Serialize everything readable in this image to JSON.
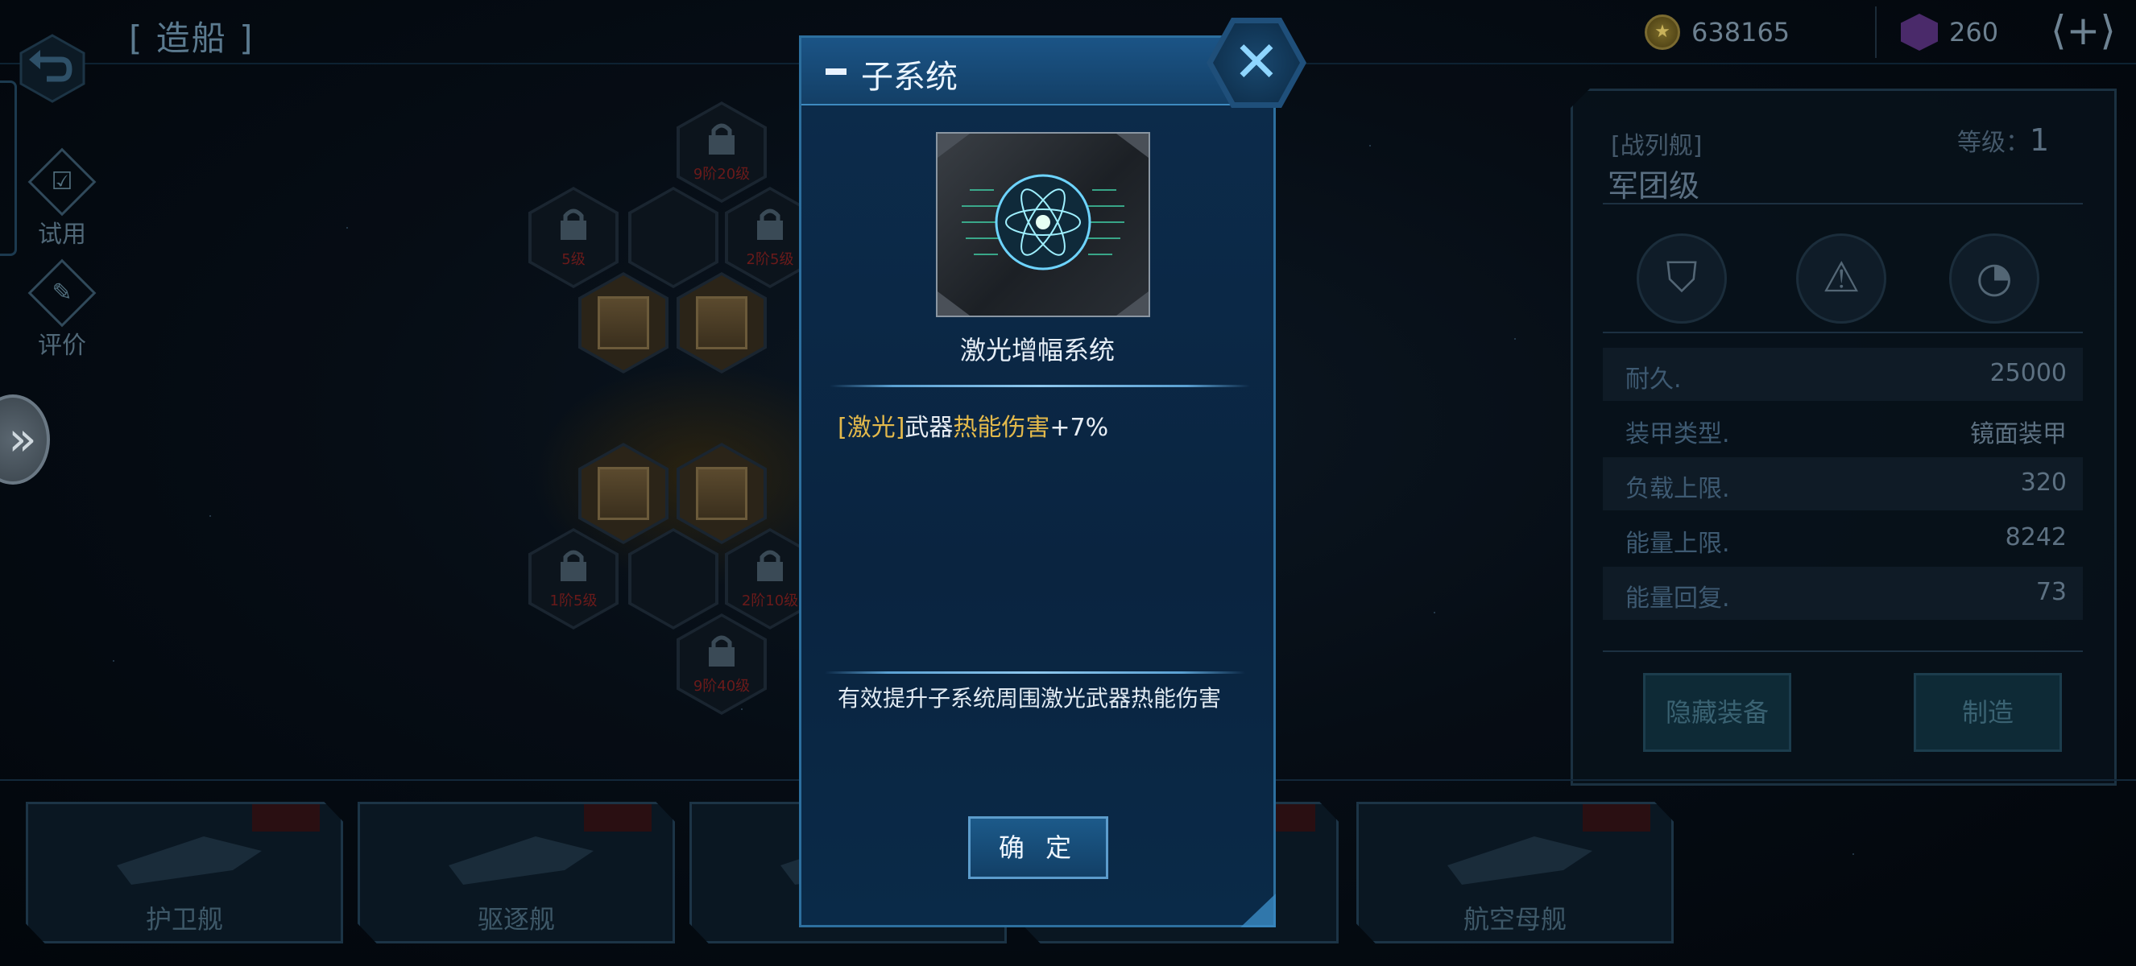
{
  "header": {
    "title": "[ 造船 ]",
    "coins": "638165",
    "gems": "260"
  },
  "sidebar": {
    "trial_label": "试用",
    "review_label": "评价"
  },
  "slots": [
    {
      "label": "9阶20级"
    },
    {
      "label": "5级"
    },
    {
      "label": "2阶5级"
    },
    {
      "label": "1阶5级"
    },
    {
      "label": "2阶10级"
    },
    {
      "label": "9阶40级"
    }
  ],
  "ship_panel": {
    "ship_class": "[战列舰]",
    "level_label": "等级：",
    "level_value": "1",
    "ship_name": "军团级",
    "stats": [
      {
        "label": "耐久.",
        "value": "25000"
      },
      {
        "label": "装甲类型.",
        "value": "镜面装甲"
      },
      {
        "label": "负载上限.",
        "value": "320"
      },
      {
        "label": "能量上限.",
        "value": "8242"
      },
      {
        "label": "能量回复.",
        "value": "73"
      }
    ],
    "hide_equipment_button": "隐藏装备",
    "build_button": "制造"
  },
  "ship_cards": [
    {
      "name": "护卫舰"
    },
    {
      "name": "驱逐舰"
    },
    {
      "name": "航空母舰"
    }
  ],
  "dialog": {
    "title": "子系统",
    "close_icon": "close-x",
    "item_name": "激光增幅系统",
    "effect_tag": "[激光]",
    "effect_mid": "武器",
    "effect_highlight": "热能伤害",
    "effect_value": "+7%",
    "description": "有效提升子系统周围激光武器热能伤害",
    "confirm_button": "确 定"
  },
  "colors": {
    "dialog_bg": "#0c2c4c",
    "dialog_border": "#2d6f9e",
    "highlight": "#e3b94b",
    "text": "#e8eef5"
  }
}
